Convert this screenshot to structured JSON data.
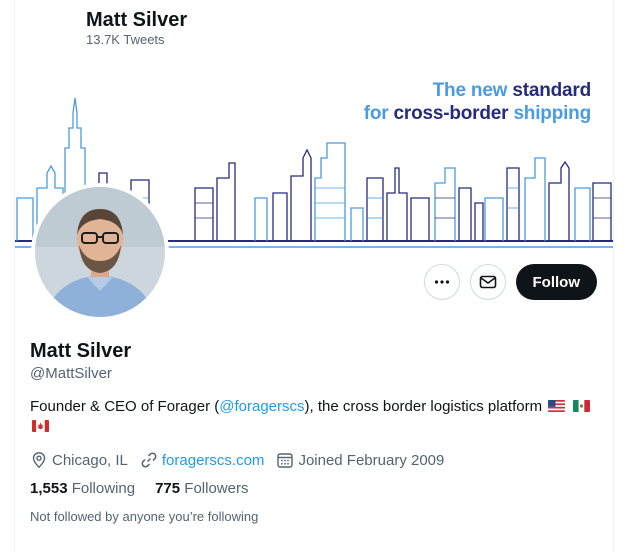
{
  "header": {
    "name": "Matt Silver",
    "tweet_count": "13.7K Tweets"
  },
  "banner": {
    "line1_a": "The new ",
    "line1_b": "standard",
    "line2_a": "for ",
    "line2_b": "cross-border ",
    "line2_c": "shipping",
    "colors": {
      "light_blue": "#4a9be0",
      "dark_blue": "#262b7d"
    }
  },
  "actions": {
    "more_icon": "more-horizontal-icon",
    "message_icon": "envelope-icon",
    "follow_label": "Follow"
  },
  "profile": {
    "name": "Matt Silver",
    "handle": "@MattSilver",
    "bio_prefix": "Founder & CEO of Forager (",
    "bio_mention": "@foragerscs",
    "bio_suffix": "), the cross border logistics platform",
    "location": "Chicago, IL",
    "website": "foragerscs.com",
    "joined": "Joined February 2009",
    "following_count": "1,553",
    "following_label": "Following",
    "followers_count": "775",
    "followers_label": "Followers",
    "not_followed_text": "Not followed by anyone you’re following"
  },
  "colors": {
    "accent": "#1d9bf0",
    "text": "#0f1419",
    "secondary": "#536471"
  }
}
